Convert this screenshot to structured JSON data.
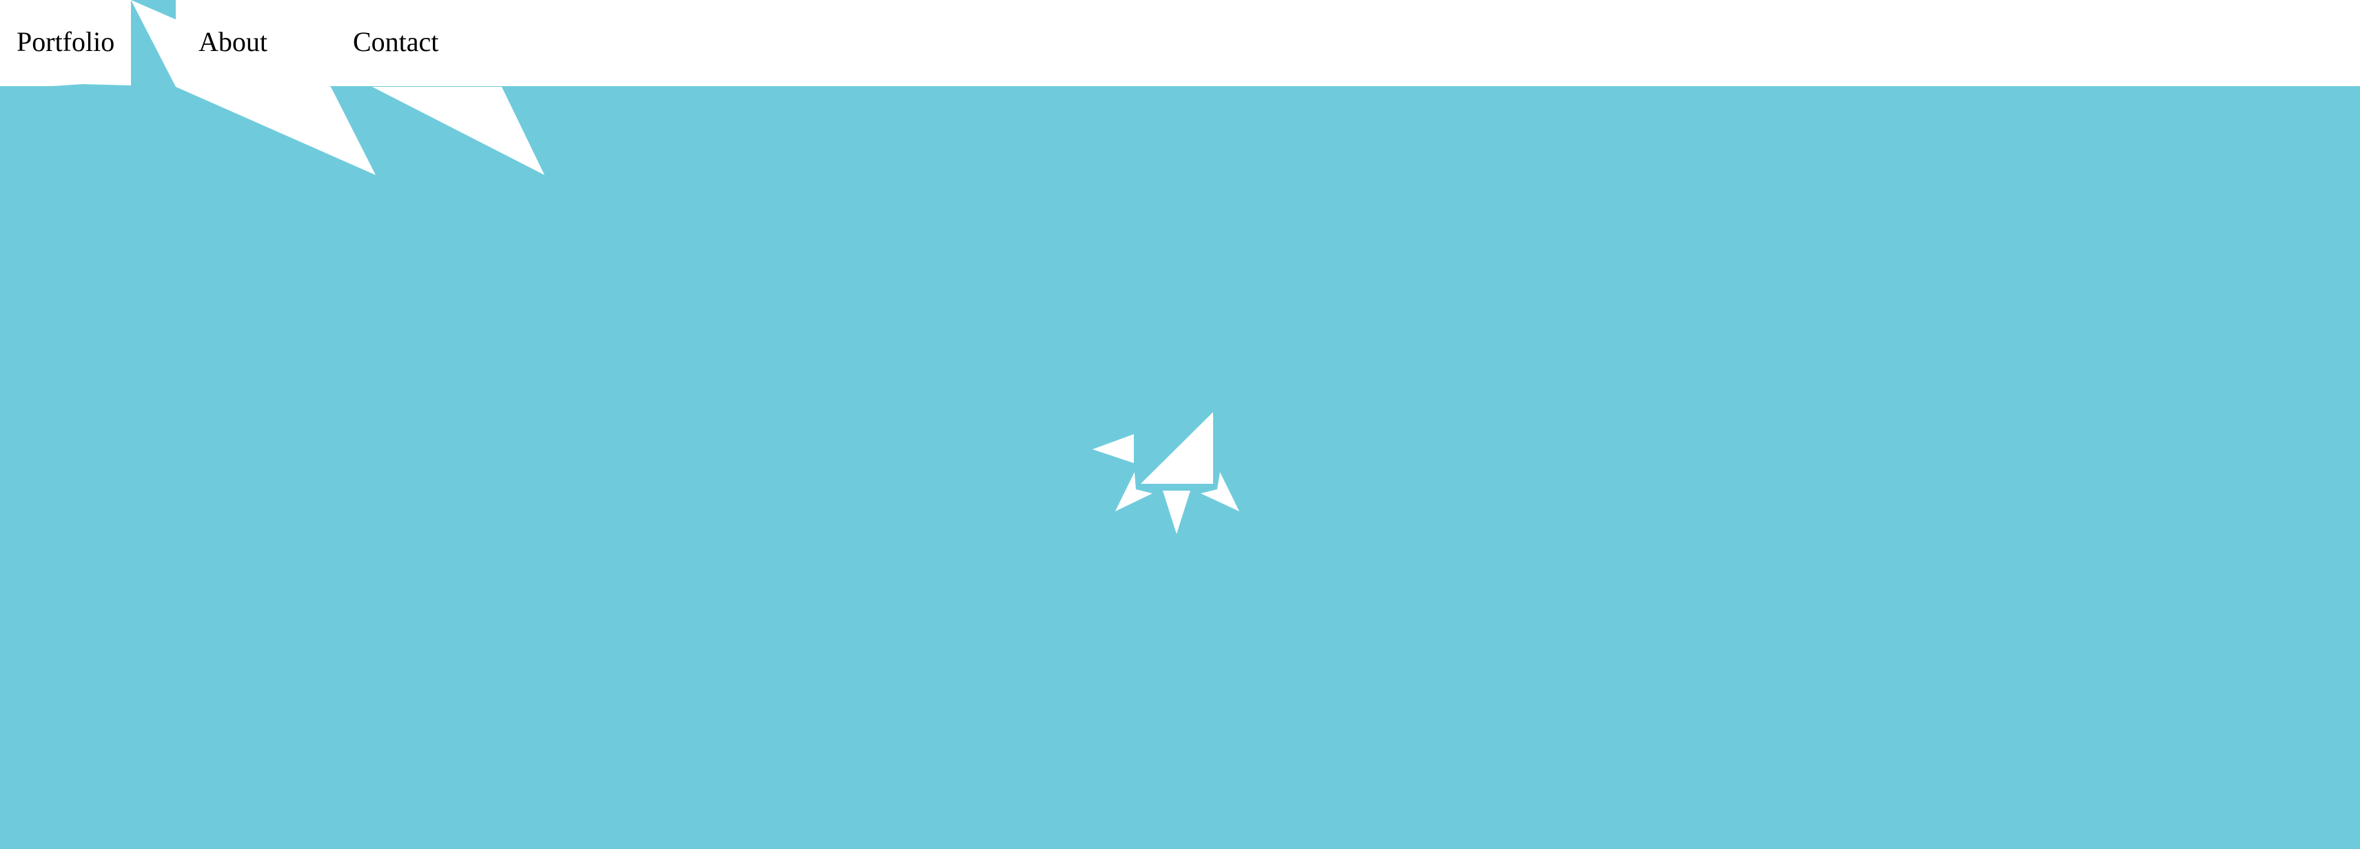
{
  "nav": {
    "items": [
      {
        "label": "Portfolio"
      },
      {
        "label": "About"
      },
      {
        "label": "Contact"
      }
    ]
  },
  "colors": {
    "background": "#6fcbdc",
    "navbar": "#ffffff",
    "text": "#000000",
    "logo": "#ffffff"
  },
  "icons": {
    "logo": "origami-bird-icon"
  }
}
